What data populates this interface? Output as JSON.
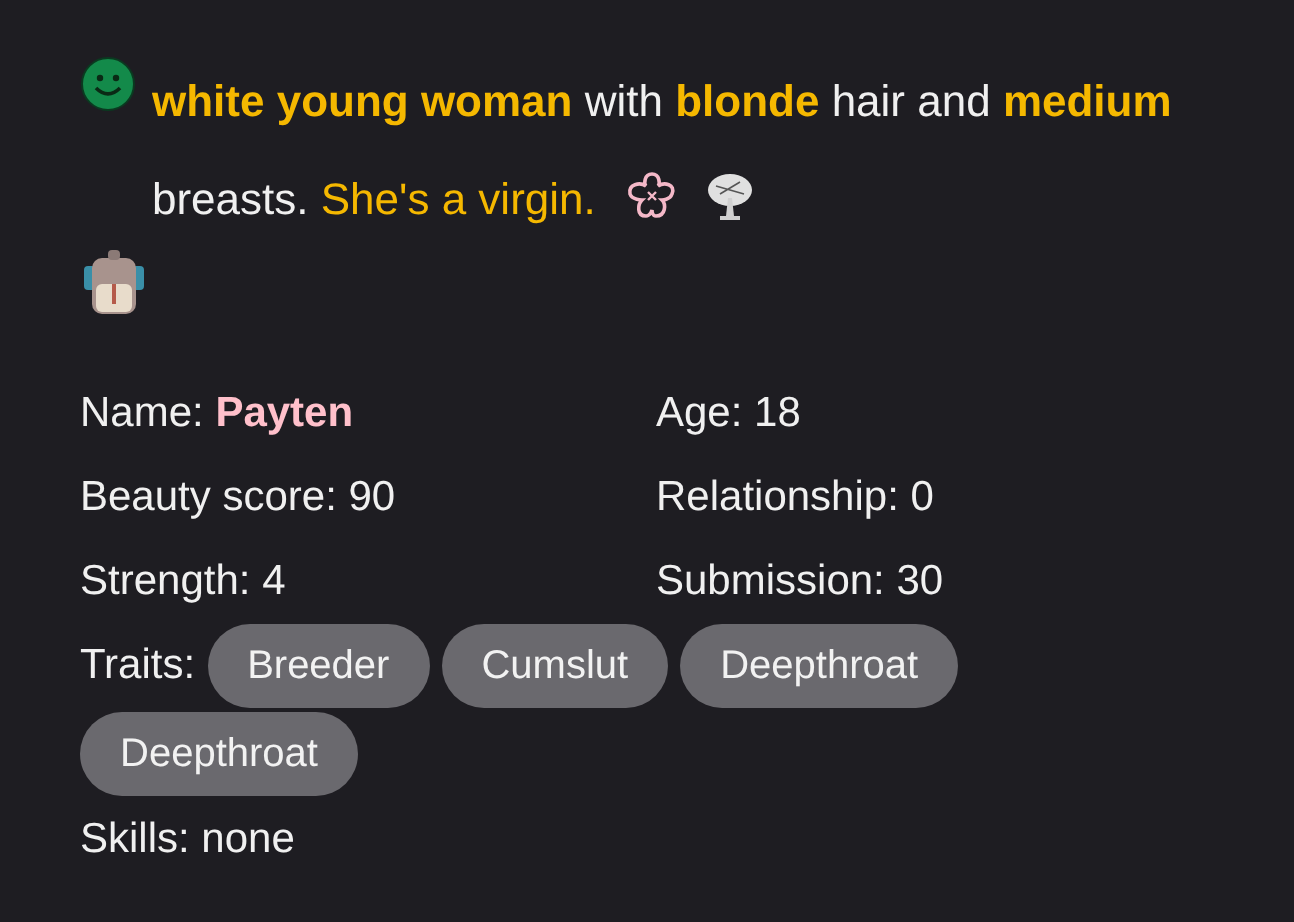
{
  "description": [
    {
      "kind": "key",
      "text": "white young woman"
    },
    {
      "kind": "plain",
      "text": " with "
    },
    {
      "kind": "key",
      "text": "blonde"
    },
    {
      "kind": "plain",
      "text": " hair and "
    },
    {
      "kind": "key",
      "text": "medium"
    },
    {
      "kind": "plain",
      "text": " breasts. "
    },
    {
      "kind": "note",
      "text": "She's a virgin."
    }
  ],
  "stats": [
    {
      "label": "Name: ",
      "value": "Payten",
      "kind": "name"
    },
    {
      "label": "Age: ",
      "value": "18",
      "kind": "plain"
    },
    {
      "label": "Beauty score: ",
      "value": "90",
      "kind": "plain"
    },
    {
      "label": "Relationship: ",
      "value": "0",
      "kind": "plain"
    },
    {
      "label": "Strength: ",
      "value": "4",
      "kind": "plain"
    },
    {
      "label": "Submission: ",
      "value": "30",
      "kind": "plain"
    }
  ],
  "traits": {
    "label": "Traits:",
    "items": [
      "Breeder",
      "Cumslut",
      "Deepthroat",
      "Deepthroat"
    ]
  },
  "skills": "Skills: none"
}
